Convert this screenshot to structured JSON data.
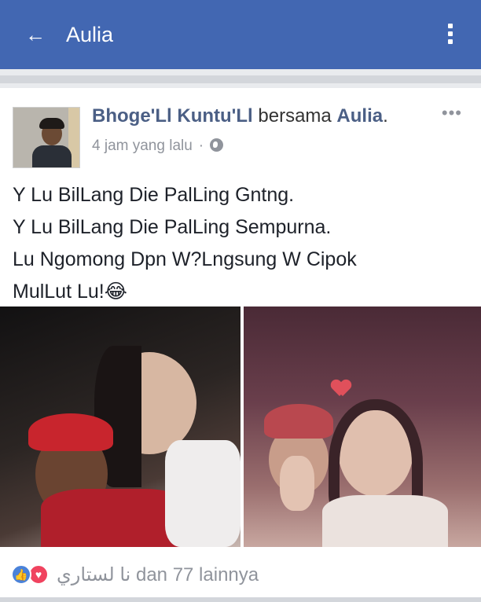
{
  "appbar": {
    "title": "Aulia",
    "back_icon": "arrow-left-icon",
    "menu_icon": "more-vertical-icon",
    "background": "#4267b2"
  },
  "post": {
    "author_name": "Bhoge'Ll Kuntu'Ll",
    "with_word": "bersama",
    "tagged_name": "Aulia",
    "tagged_suffix": ".",
    "timestamp": "4 jam yang lalu",
    "separator": "·",
    "privacy_icon": "globe-icon",
    "options_icon": "more-horizontal-icon",
    "text_lines": [
      "Y Lu BilLang Die PalLing Gntng.",
      "Y Lu BilLang Die PalLing Sempurna.",
      "Lu  Ngomong Dpn W?Lngsung W Cipok",
      "MulLut Lu!😂"
    ],
    "photos": [
      {
        "name": "photo-1",
        "content": "two people selfie at night, boy in red cap and girl sticking out tongue"
      },
      {
        "name": "photo-2",
        "content": "two people selfie, boy in red cap covering face and smiling girl with heart sticker"
      }
    ]
  },
  "reactions": {
    "like_icon": "thumbs-up-icon",
    "love_icon": "heart-icon",
    "text": "نا لستاري dan 77 lainnya",
    "like_color": "#4a82d9",
    "love_color": "#f0435f"
  }
}
